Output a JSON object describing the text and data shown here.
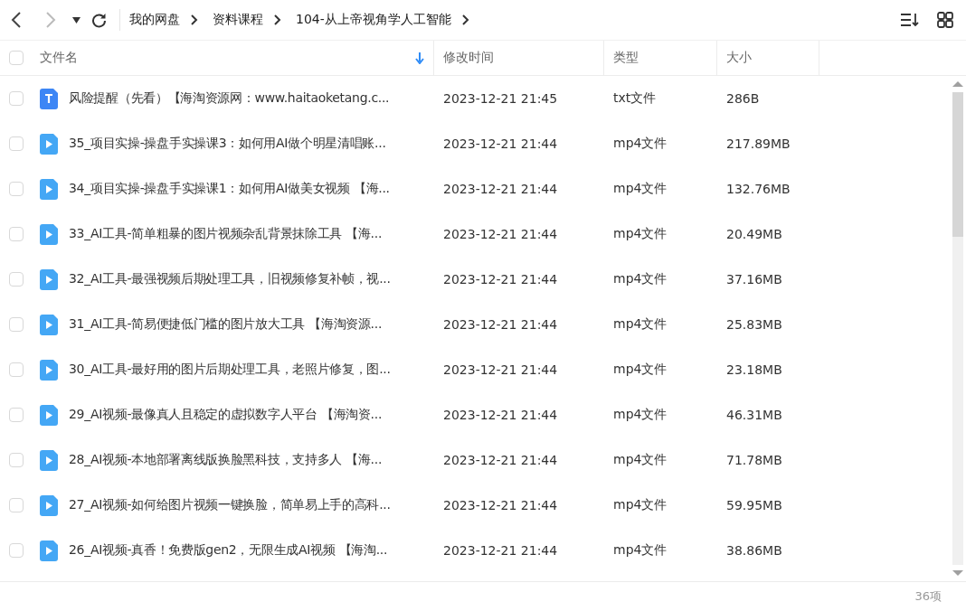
{
  "toolbar": {
    "breadcrumb": [
      "我的网盘",
      "资料课程",
      "104-从上帝视角学人工智能"
    ]
  },
  "table": {
    "columns": [
      {
        "label": "文件名",
        "sorted": true
      },
      {
        "label": "修改时间",
        "sorted": false
      },
      {
        "label": "类型",
        "sorted": false
      },
      {
        "label": "大小",
        "sorted": false
      }
    ],
    "all_checked": false,
    "rows": [
      {
        "kind": "text",
        "name": "风险提醒（先看）【海淘资源网：www.haitaoketang.c...",
        "modified": "2023-12-21 21:45",
        "type": "txt文件",
        "size": "286B",
        "checked": false
      },
      {
        "kind": "video",
        "name": "35_项目实操-操盘手实操课3：如何用AI做个明星清唱账...",
        "modified": "2023-12-21 21:44",
        "type": "mp4文件",
        "size": "217.89MB",
        "checked": false
      },
      {
        "kind": "video",
        "name": "34_项目实操-操盘手实操课1：如何用AI做美女视频 【海...",
        "modified": "2023-12-21 21:44",
        "type": "mp4文件",
        "size": "132.76MB",
        "checked": false
      },
      {
        "kind": "video",
        "name": "33_AI工具-简单粗暴的图片视频杂乱背景抹除工具 【海...",
        "modified": "2023-12-21 21:44",
        "type": "mp4文件",
        "size": "20.49MB",
        "checked": false
      },
      {
        "kind": "video",
        "name": "32_AI工具-最强视频后期处理工具，旧视频修复补帧，视...",
        "modified": "2023-12-21 21:44",
        "type": "mp4文件",
        "size": "37.16MB",
        "checked": false
      },
      {
        "kind": "video",
        "name": "31_AI工具-简易便捷低门槛的图片放大工具 【海淘资源...",
        "modified": "2023-12-21 21:44",
        "type": "mp4文件",
        "size": "25.83MB",
        "checked": false
      },
      {
        "kind": "video",
        "name": "30_AI工具-最好用的图片后期处理工具，老照片修复，图...",
        "modified": "2023-12-21 21:44",
        "type": "mp4文件",
        "size": "23.18MB",
        "checked": false
      },
      {
        "kind": "video",
        "name": "29_AI视频-最像真人且稳定的虚拟数字人平台 【海淘资...",
        "modified": "2023-12-21 21:44",
        "type": "mp4文件",
        "size": "46.31MB",
        "checked": false
      },
      {
        "kind": "video",
        "name": "28_AI视频-本地部署离线版换脸黑科技，支持多人 【海...",
        "modified": "2023-12-21 21:44",
        "type": "mp4文件",
        "size": "71.78MB",
        "checked": false
      },
      {
        "kind": "video",
        "name": "27_AI视频-如何给图片视频一键换脸，简单易上手的高科...",
        "modified": "2023-12-21 21:44",
        "type": "mp4文件",
        "size": "59.95MB",
        "checked": false
      },
      {
        "kind": "video",
        "name": "26_AI视频-真香！免费版gen2，无限生成AI视频 【海淘...",
        "modified": "2023-12-21 21:44",
        "type": "mp4文件",
        "size": "38.86MB",
        "checked": false
      }
    ]
  },
  "status_bar": {
    "count": "36项"
  }
}
